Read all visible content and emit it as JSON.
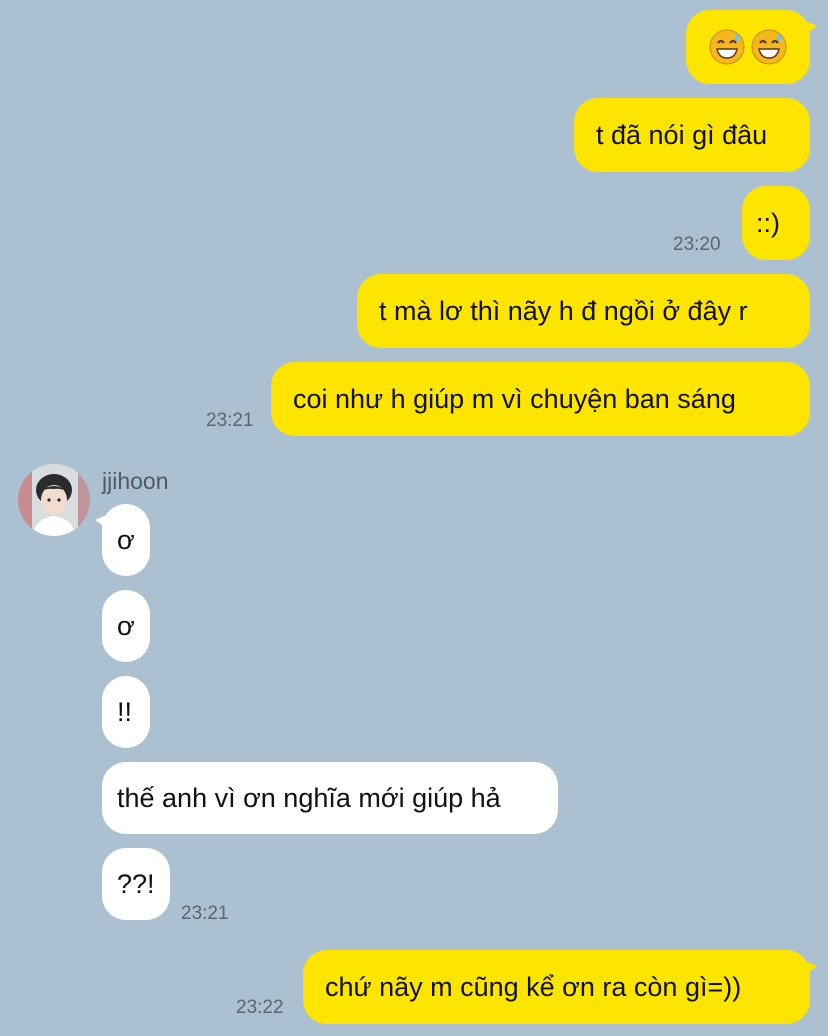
{
  "chat": {
    "messages": [
      {
        "from": "me",
        "emoji": [
          "grinning-sweat-face",
          "grinning-sweat-face"
        ]
      },
      {
        "from": "me",
        "text": "t đã nói gì đâu"
      },
      {
        "from": "me",
        "text": "::)",
        "time": "23:20"
      },
      {
        "from": "me",
        "text": "t mà lơ thì nãy h đ ngồi ở đây r"
      },
      {
        "from": "me",
        "text": "coi như h giúp m vì chuyện ban sáng",
        "time": "23:21"
      },
      {
        "from": "them",
        "text": "ơ"
      },
      {
        "from": "them",
        "text": "ơ"
      },
      {
        "from": "them",
        "text": "!!"
      },
      {
        "from": "them",
        "text": "thế anh vì ơn nghĩa mới giúp hả"
      },
      {
        "from": "them",
        "text": "??!",
        "time": "23:21"
      },
      {
        "from": "me",
        "text": "chứ nãy m cũng kể ơn ra còn gì=))",
        "time": "23:22"
      }
    ],
    "contact": {
      "name": "jjihoon",
      "avatar": "profile-photo"
    }
  },
  "colors": {
    "background": "#abc1d1",
    "my_bubble": "#fee500",
    "their_bubble": "#ffffff",
    "timestamp": "#5a6672"
  }
}
